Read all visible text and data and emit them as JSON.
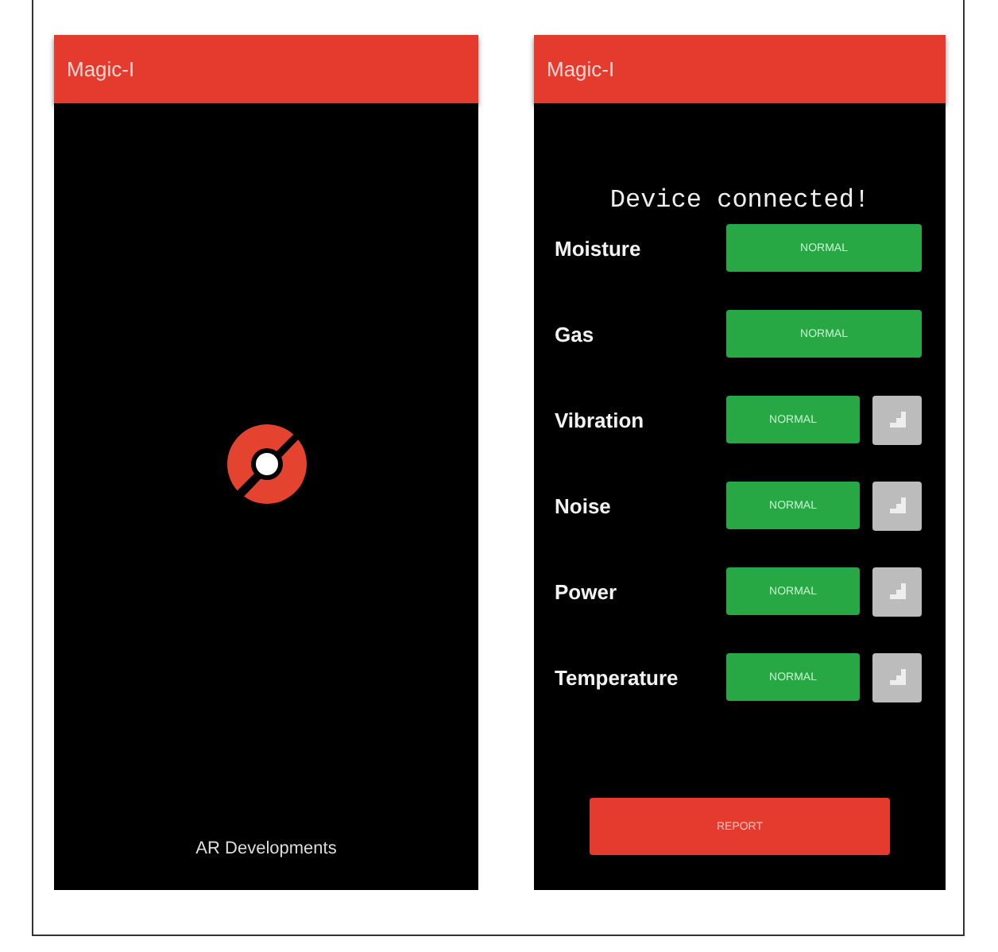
{
  "screens": [
    {
      "kind": "splash",
      "title": "Magic-I",
      "footer": "AR Developments"
    },
    {
      "kind": "sensors",
      "title": "Magic-I",
      "heading": "Device connected!",
      "rows": [
        {
          "label": "Moisture",
          "status": "NORMAL",
          "kind": "status"
        },
        {
          "label": "Gas",
          "status": "NORMAL",
          "kind": "status"
        },
        {
          "label": "Vibration",
          "status": "NORMAL",
          "kind": "status-chart"
        },
        {
          "label": "Noise",
          "status": "NORMAL",
          "kind": "status-chart"
        },
        {
          "label": "Power",
          "status": "NORMAL",
          "kind": "status-chart"
        },
        {
          "label": "Temperature",
          "status": "NORMAL",
          "kind": "status-chart"
        }
      ],
      "button": "REPORT"
    }
  ]
}
